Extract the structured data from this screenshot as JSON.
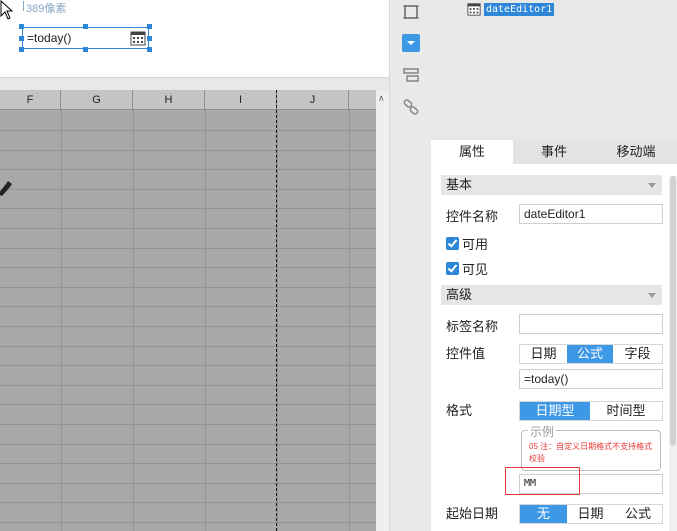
{
  "canvas": {
    "pixel_hint": "389像素",
    "date_editor_value": "=today()"
  },
  "sheet": {
    "columns": [
      "F",
      "G",
      "H",
      "I",
      "J"
    ]
  },
  "tree": {
    "widget_name": "dateEditor1"
  },
  "panel": {
    "tabs": [
      "属性",
      "事件",
      "移动端"
    ],
    "active_tab": "属性",
    "section_basic": "基本",
    "widget_name_label": "控件名称",
    "widget_name_value": "dateEditor1",
    "enabled_label": "可用",
    "visible_label": "可见",
    "section_advanced": "高级",
    "tag_name_label": "标签名称",
    "tag_name_value": "",
    "widget_value_label": "控件值",
    "value_type_options": [
      "日期",
      "公式",
      "字段"
    ],
    "value_type_selected": "公式",
    "widget_value": "=today()",
    "format_label": "格式",
    "format_type_options": [
      "日期型",
      "时间型"
    ],
    "format_type_selected": "日期型",
    "example_legend": "示例",
    "example_note": "05 注：自定义日期格式不支持格式校验",
    "format_value": "MM",
    "start_date_label": "起始日期",
    "start_date_options": [
      "无",
      "日期",
      "公式"
    ],
    "start_date_selected": "无"
  },
  "colors": {
    "accent": "#3d98e6",
    "selection_border": "#2d86d8",
    "note_red": "#e53935",
    "sheet_bg": "#a9a9a9"
  }
}
